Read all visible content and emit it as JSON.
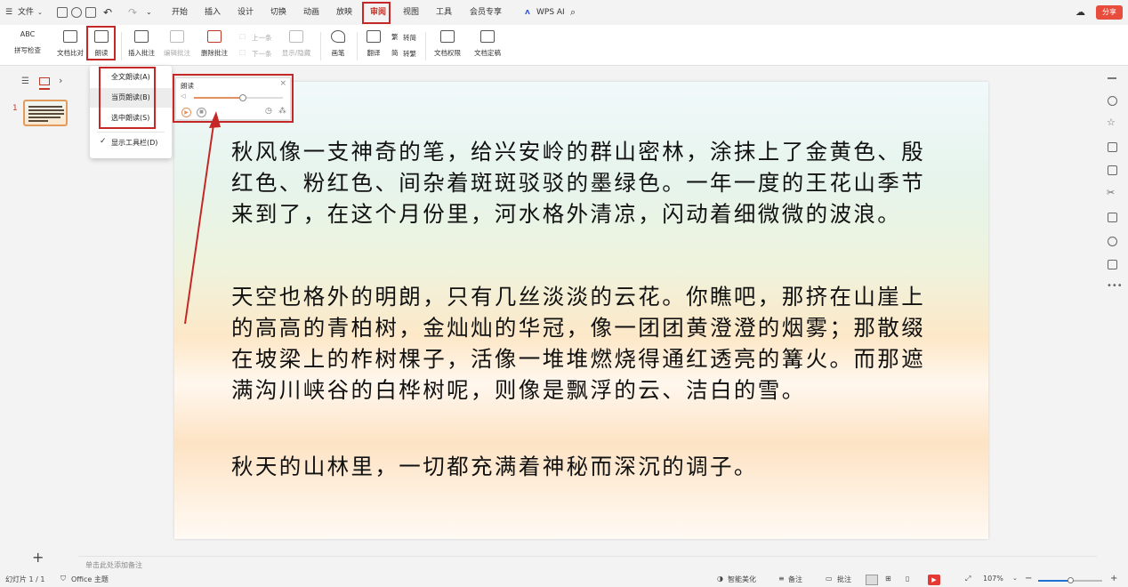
{
  "menu": {
    "file": "文件",
    "tabs": [
      "开始",
      "插入",
      "设计",
      "切换",
      "动画",
      "放映",
      "审阅",
      "视图",
      "工具",
      "会员专享"
    ],
    "active_tab": "审阅",
    "ai_label": "WPS AI",
    "share_label": "分享"
  },
  "ribbon": {
    "spellcheck_icon": "ABC",
    "spellcheck": "拼写检查",
    "compare": "文档比对",
    "read_aloud": "朗读",
    "insert_comment": "插入批注",
    "edit_comment": "编辑批注",
    "delete_comment": "删除批注",
    "prev": "上一条",
    "next": "下一条",
    "show_hide": "显示/隐藏",
    "pen": "画笔",
    "translate": "翻译",
    "to_simplified": "转简",
    "to_traditional": "转繁",
    "doc_permission": "文档权限",
    "doc_finalize": "文档定稿"
  },
  "dropdown": {
    "items": [
      "全文朗读(A)",
      "当页朗读(B)",
      "选中朗读(S)"
    ],
    "toolbar_option": "显示工具栏(D)"
  },
  "reader": {
    "title": "朗读",
    "volume_level": 0.55
  },
  "slide": {
    "paragraphs": [
      "秋风像一支神奇的笔，给兴安岭的群山密林，涂抹上了金黄色、殷红色、粉红色、间杂着斑斑驳驳的墨绿色。一年一度的王花山季节来到了，在这个月份里，河水格外清凉，闪动着细微微的波浪。",
      "天空也格外的明朗，只有几丝淡淡的云花。你瞧吧，那挤在山崖上的高高的青柏树，金灿灿的华冠，像一团团黄澄澄的烟雾；那散缀在坡梁上的柞树棵子，活像一堆堆燃烧得通红透亮的篝火。而那遮满沟川峡谷的白桦树呢，则像是飘浮的云、洁白的雪。",
      "秋天的山林里，一切都充满着神秘而深沉的调子。"
    ]
  },
  "left_panel": {
    "slide_number": "1",
    "add_slide": "+"
  },
  "notes_placeholder": "单击此处添加备注",
  "status": {
    "slide_info": "幻灯片 1 / 1",
    "theme": "Office 主题",
    "beautify": "智能美化",
    "notes": "备注",
    "comments": "批注",
    "zoom": "107%",
    "zoom_level": 0.5
  },
  "colors": {
    "accent": "#c62828",
    "active_tab": "#c0392b",
    "slider": "#e59060",
    "thumb_border": "#e39b5c"
  }
}
